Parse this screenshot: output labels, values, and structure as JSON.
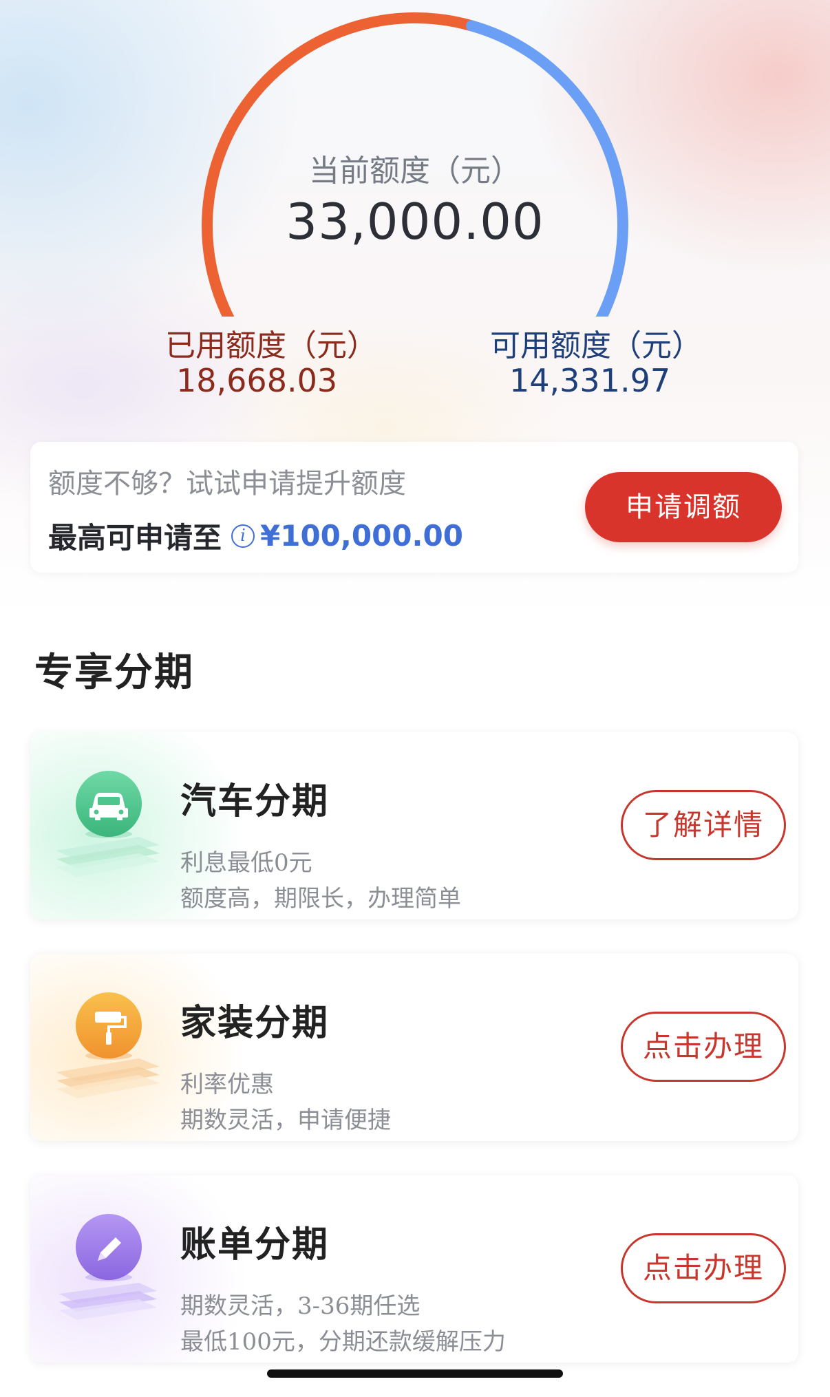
{
  "quota": {
    "current_label": "当前额度（元）",
    "current_value": "33,000.00",
    "used_label": "已用额度（元）",
    "used_value": "18,668.03",
    "available_label": "可用额度（元）",
    "available_value": "14,331.97",
    "used_fraction": 0.5657,
    "colors": {
      "used": "#ec6233",
      "available": "#6a9ff5"
    }
  },
  "apply": {
    "hint": "额度不够？试试申请提升额度",
    "max_label": "最高可申请至",
    "info_icon": "info-icon",
    "max_amount": "¥100,000.00",
    "button": "申请调额"
  },
  "section": {
    "title": "专享分期"
  },
  "products": [
    {
      "title": "汽车分期",
      "line1": "利息最低0元",
      "line2": "额度高，期限长，办理简单",
      "button": "了解详情",
      "icon": "car-icon",
      "color": "#3fbf86"
    },
    {
      "title": "家装分期",
      "line1": "利率优惠",
      "line2": "期数灵活，申请便捷",
      "button": "点击办理",
      "icon": "paint-roller-icon",
      "color": "#f3a23a"
    },
    {
      "title": "账单分期",
      "line1": "期数灵活，3-36期任选",
      "line2": "最低100元，分期还款缓解压力",
      "button": "点击办理",
      "icon": "pencil-icon",
      "color": "#9a78e8"
    }
  ]
}
